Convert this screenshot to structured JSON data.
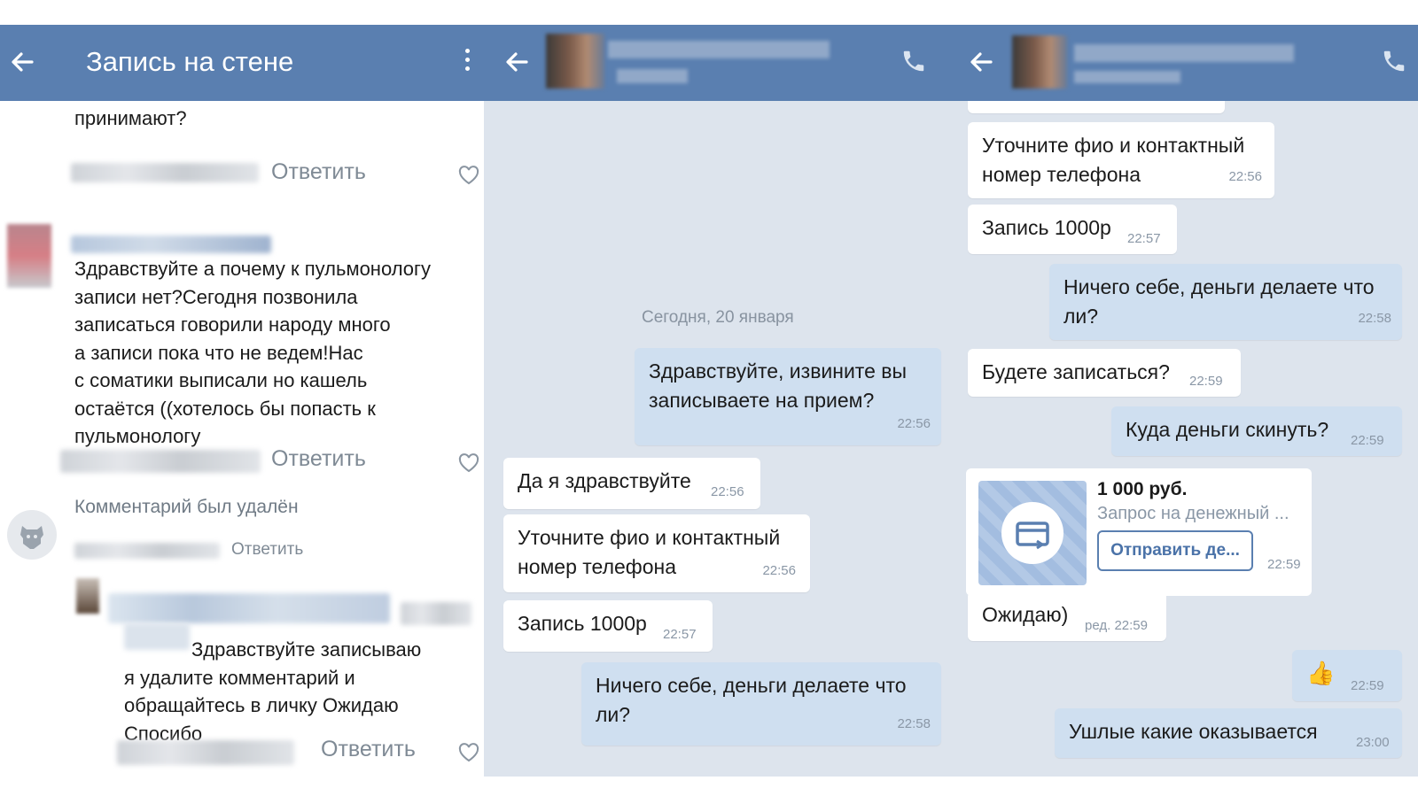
{
  "wall": {
    "title": "Запись на стене",
    "comments": [
      {
        "text_partial": "принимают?",
        "reply": "Ответить"
      },
      {
        "lines": [
          "Здравствуйте а почему к пульмонологу",
          "записи нет?Сегодня позвонила",
          "записаться говорили народу много",
          "а записи пока что не ведем!Нас",
          "с соматики выписали но кашель",
          "остаётся ((хотелось бы попасть к",
          "пульмонологу"
        ],
        "reply": "Ответить"
      },
      {
        "deleted_text": "Комментарий был удалён",
        "reply": "Ответить"
      },
      {
        "lines": [
          "Здравствуйте записываю",
          "я удалите комментарий и",
          "обращайтесь в личку Ожидаю",
          "Спосибо"
        ],
        "reply": "Ответить"
      }
    ]
  },
  "chat1": {
    "date_separator": "Сегодня, 20 января",
    "messages": [
      {
        "dir": "out",
        "lines": [
          "Здравствуйте, извините вы",
          "записываете на прием?"
        ],
        "time": "22:56"
      },
      {
        "dir": "in",
        "lines": [
          "Да я здравствуйте"
        ],
        "time": "22:56"
      },
      {
        "dir": "in",
        "lines": [
          "Уточните фио и контактный",
          "номер телефона"
        ],
        "time": "22:56"
      },
      {
        "dir": "in",
        "lines": [
          "Запись 1000р"
        ],
        "time": "22:57"
      },
      {
        "dir": "out",
        "lines": [
          "Ничего себе, деньги делаете что",
          "ли?"
        ],
        "time": "22:58"
      }
    ]
  },
  "chat2": {
    "messages": [
      {
        "dir": "in",
        "lines": [
          "Уточните фио и контактный",
          "номер телефона"
        ],
        "time": "22:56"
      },
      {
        "dir": "in",
        "lines": [
          "Запись 1000р"
        ],
        "time": "22:57"
      },
      {
        "dir": "out",
        "lines": [
          "Ничего себе, деньги делаете что",
          "ли?"
        ],
        "time": "22:58"
      },
      {
        "dir": "in",
        "lines": [
          "Будете записаться?"
        ],
        "time": "22:59"
      },
      {
        "dir": "out",
        "lines": [
          "Куда деньги скинуть?"
        ],
        "time": "22:59"
      },
      {
        "dir": "in",
        "lines": [
          "Ожидаю)"
        ],
        "time": "ред. 22:59"
      },
      {
        "dir": "out",
        "lines": [
          "👍"
        ],
        "time": "22:59"
      },
      {
        "dir": "out",
        "lines": [
          "Ушлые какие оказывается"
        ],
        "time": "23:00"
      }
    ],
    "payment": {
      "amount": "1 000 руб.",
      "description": "Запрос на денежный ...",
      "button": "Отправить де...",
      "time": "22:59"
    }
  },
  "icons": {
    "back": "arrow-left-icon",
    "menu": "more-vertical-icon",
    "call": "phone-icon",
    "like": "heart-icon",
    "card": "credit-card-icon"
  },
  "colors": {
    "header": "#5a7fb0",
    "chat_bg": "#dde4ed",
    "bubble_out": "#cfdff0",
    "bubble_in": "#ffffff",
    "accent": "#4a72a8"
  }
}
